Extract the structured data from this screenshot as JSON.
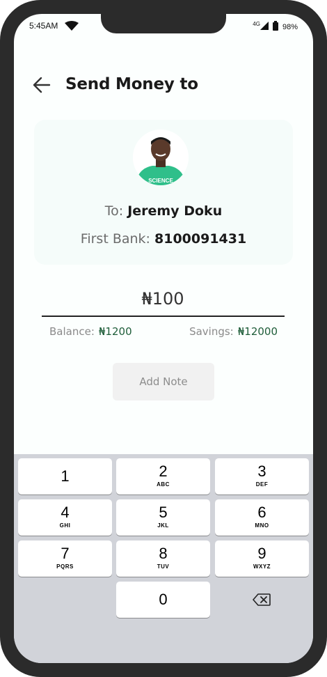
{
  "status_bar": {
    "time": "5:45AM",
    "network": "4G",
    "battery": "98%"
  },
  "header": {
    "title": "Send Money to",
    "back_icon": "arrow-left-icon"
  },
  "recipient": {
    "to_label": "To:",
    "name": "Jeremy Doku",
    "bank_label": "First Bank:",
    "account_number": "8100091431",
    "avatar_shirt_text": "SCIENCE"
  },
  "amount": {
    "value": "₦100"
  },
  "balances": {
    "balance_label": "Balance:",
    "balance_value": "₦1200",
    "savings_label": "Savings:",
    "savings_value": "₦12000"
  },
  "actions": {
    "add_note_label": "Add Note"
  },
  "keypad": {
    "keys": [
      {
        "num": "1",
        "sub": ""
      },
      {
        "num": "2",
        "sub": "ABC"
      },
      {
        "num": "3",
        "sub": "DEF"
      },
      {
        "num": "4",
        "sub": "GHI"
      },
      {
        "num": "5",
        "sub": "JKL"
      },
      {
        "num": "6",
        "sub": "MNO"
      },
      {
        "num": "7",
        "sub": "PQRS"
      },
      {
        "num": "8",
        "sub": "TUV"
      },
      {
        "num": "9",
        "sub": "WXYZ"
      },
      {
        "num": "0",
        "sub": ""
      }
    ],
    "delete_icon": "backspace-icon"
  },
  "colors": {
    "accent_green": "#1f5e3a",
    "card_bg": "#f5fcfa",
    "keypad_bg": "#d1d3d9"
  }
}
